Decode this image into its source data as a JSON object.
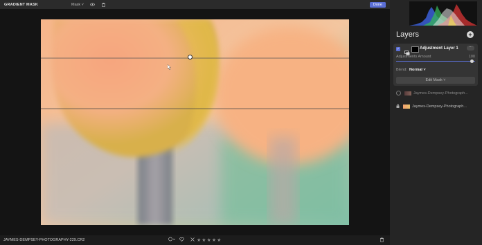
{
  "topbar": {
    "title": "GRADIENT MASK",
    "mask_label": "Mask ˅",
    "eye_icon": "eye-icon",
    "trash_icon": "trash-icon",
    "done_label": "Done"
  },
  "bottombar": {
    "filename": "JAYMES-DEMPSEY-PHOTOGRAPHY-229.CR2",
    "flag_icon": "circle-flag-icon",
    "heart_icon": "heart-icon",
    "reject_icon": "reject-x-icon",
    "rating_stars": 5,
    "star_glyph": "★",
    "trash_icon": "trash-icon"
  },
  "panel": {
    "layers_title": "Layers",
    "add_label": "+",
    "active_layer": {
      "name": "Adjustment Layer 1",
      "more_label": "···",
      "checked": true,
      "amount_label": "Adjustments Amount",
      "amount_value": "100",
      "amount_fraction": 1.0,
      "blend_label": "Blend:",
      "blend_value": "Normal ˅",
      "edit_mask_label": "Edit Mask ˅"
    },
    "other_layers": [
      {
        "name": "Jaymes-Dempsey-Photograph...",
        "locked": false
      },
      {
        "name": "Jaymes-Dempsey-Photograph...",
        "locked": true
      }
    ]
  },
  "colors": {
    "accent": "#5b6fd6",
    "panel_bg": "#252525",
    "topbar_bg": "#2b2b2b"
  }
}
